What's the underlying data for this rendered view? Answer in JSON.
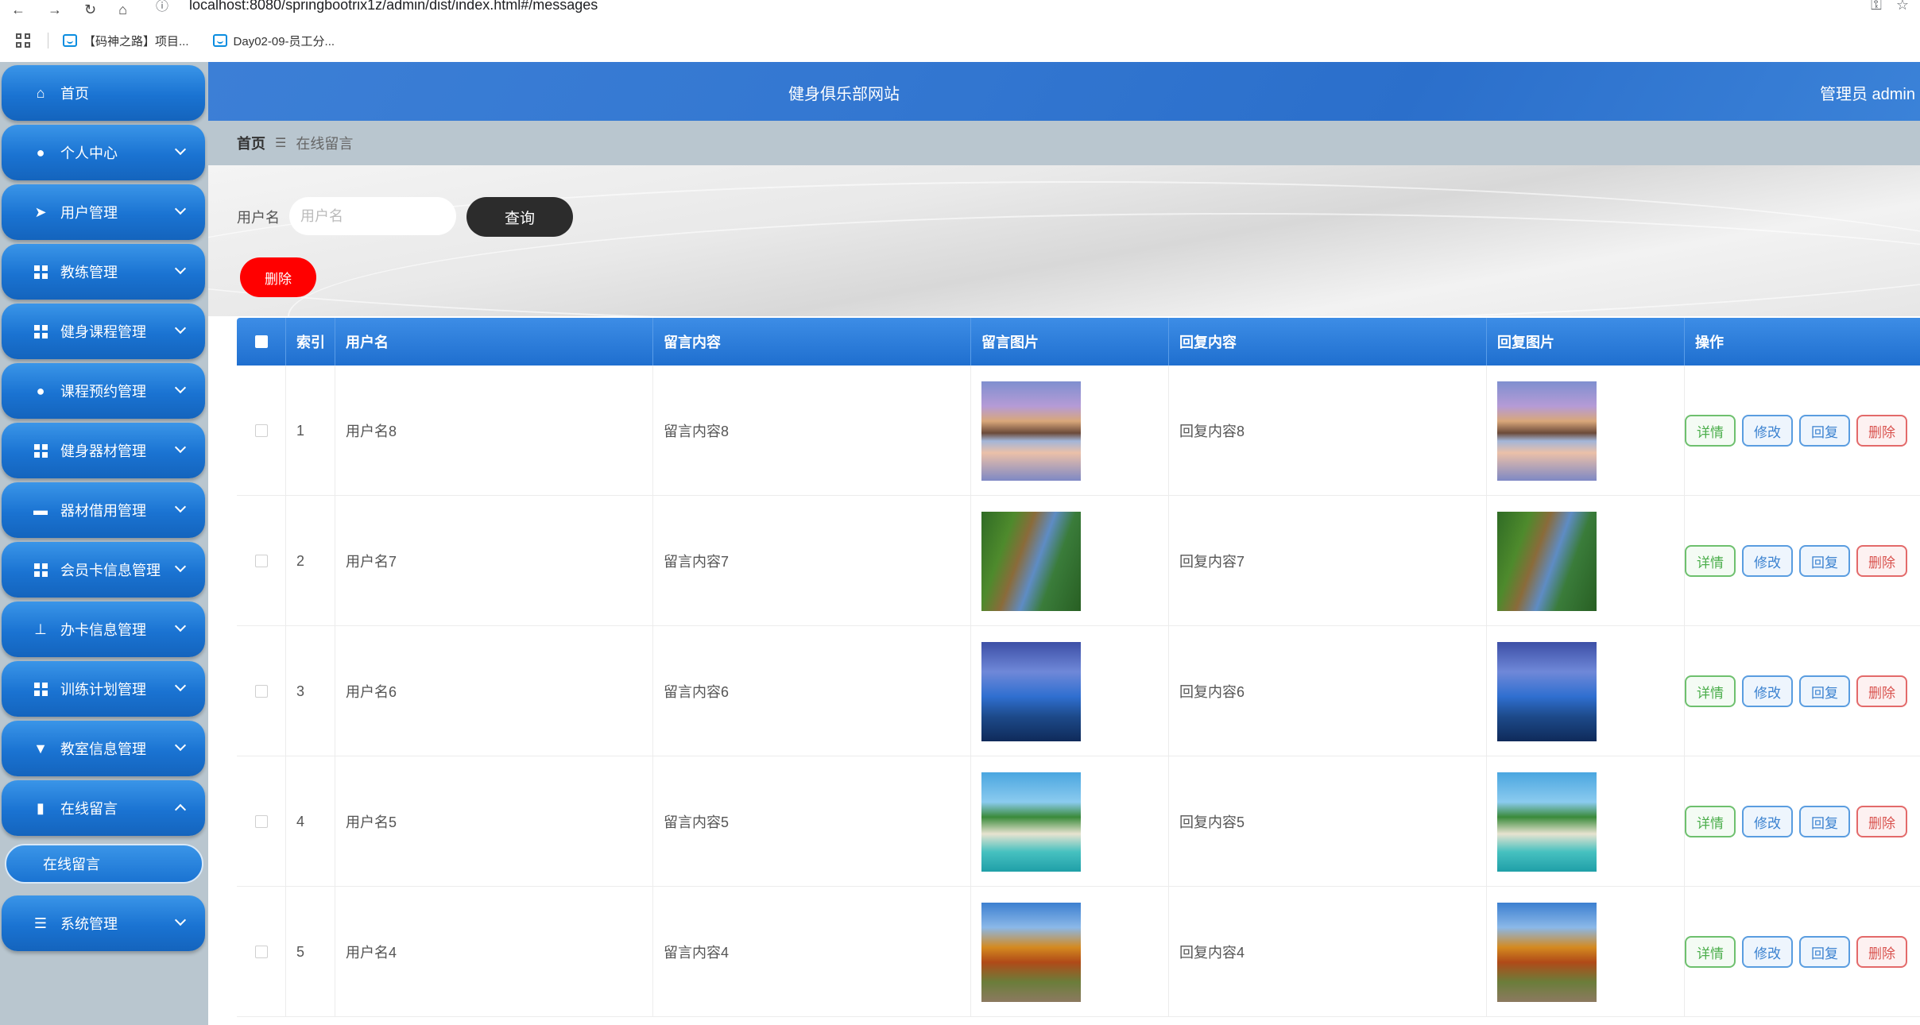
{
  "browser": {
    "url": "localhost:8080/springbootrix1z/admin/dist/index.html#/messages",
    "bookmarks": [
      {
        "label": "【码神之路】项目..."
      },
      {
        "label": "Day02-09-员工分..."
      }
    ]
  },
  "header": {
    "site_title": "健身俱乐部网站",
    "admin_label": "管理员 admin"
  },
  "sidebar": {
    "items": [
      {
        "label": "首页",
        "icon": "home-icon"
      },
      {
        "label": "个人中心",
        "icon": "user-icon"
      },
      {
        "label": "用户管理",
        "icon": "send-icon"
      },
      {
        "label": "教练管理",
        "icon": "grid-icon"
      },
      {
        "label": "健身课程管理",
        "icon": "grid-icon"
      },
      {
        "label": "课程预约管理",
        "icon": "user-icon"
      },
      {
        "label": "健身器材管理",
        "icon": "grid-icon"
      },
      {
        "label": "器材借用管理",
        "icon": "ticket-icon"
      },
      {
        "label": "会员卡信息管理",
        "icon": "grid-icon"
      },
      {
        "label": "办卡信息管理",
        "icon": "stamp-icon"
      },
      {
        "label": "训练计划管理",
        "icon": "grid-icon"
      },
      {
        "label": "教室信息管理",
        "icon": "podium-icon"
      },
      {
        "label": "在线留言",
        "icon": "chart-icon"
      },
      {
        "label": "系统管理",
        "icon": "list-icon"
      }
    ],
    "submenu": {
      "label": "在线留言"
    }
  },
  "breadcrumb": {
    "home": "首页",
    "separator": "☰",
    "current": "在线留言"
  },
  "search": {
    "label": "用户名",
    "placeholder": "用户名",
    "button": "查询"
  },
  "toolbar": {
    "delete_label": "删除"
  },
  "table": {
    "headers": [
      "",
      "索引",
      "用户名",
      "留言内容",
      "留言图片",
      "回复内容",
      "回复图片",
      "操作"
    ],
    "rows": [
      {
        "index": "1",
        "username": "用户名8",
        "content": "留言内容8",
        "reply": "回复内容8",
        "image": "mountain-lake"
      },
      {
        "index": "2",
        "username": "用户名7",
        "content": "留言内容7",
        "reply": "回复内容7",
        "image": "forest-river"
      },
      {
        "index": "3",
        "username": "用户名6",
        "content": "留言内容6",
        "reply": "回复内容6",
        "image": "rocky-coast"
      },
      {
        "index": "4",
        "username": "用户名5",
        "content": "留言内容5",
        "reply": "回复内容5",
        "image": "tropical-beach"
      },
      {
        "index": "5",
        "username": "用户名4",
        "content": "留言内容4",
        "reply": "回复内容4",
        "image": "autumn-trees"
      }
    ],
    "actions": {
      "detail": "详情",
      "edit": "修改",
      "reply": "回复",
      "delete": "删除"
    }
  },
  "colors": {
    "primary": "#1a73d2",
    "sidebar_bg": "#b9c6cf",
    "danger": "#ff0000",
    "search_btn": "#2c2c2c"
  }
}
